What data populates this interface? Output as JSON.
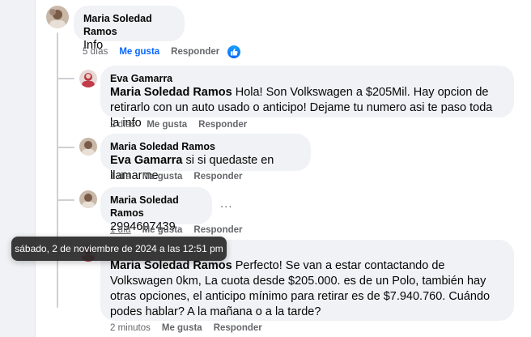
{
  "comments": [
    {
      "author": "Maria Soledad Ramos",
      "text": "Info",
      "time": "5 días",
      "like": "Me gusta",
      "reply": "Responder",
      "reaction": "like-icon"
    },
    {
      "author": "Eva Gamarra",
      "mention": "Maria Soledad Ramos",
      "text": " Hola! Son Volkswagen a $205Mil. Hay opcion de retirarlo con un auto usado o anticipo! Dejame tu numero asi te paso toda la info",
      "time": "2 días",
      "like": "Me gusta",
      "reply": "Responder"
    },
    {
      "author": "Maria Soledad Ramos",
      "mention": "Eva Gamarra",
      "text": " si si quedaste en llamarme",
      "time": "1 día",
      "like": "Me gusta",
      "reply": "Responder"
    },
    {
      "author": "Maria Soledad Ramos",
      "text": "2994697439",
      "time": "1 día",
      "like": "Me gusta",
      "reply": "Responder",
      "more": "..."
    },
    {
      "mention": "Maria Soledad Ramos",
      "text": " Perfecto! Se van a estar contactando de Volkswagen 0km, La cuota desde $205.000. es de un Polo, también hay otras opciones, el anticipo mínimo para retirar es de $7.940.760. Cuándo podes hablar? A la mañana o a la tarde?",
      "time": "2 minutos",
      "like": "Me gusta",
      "reply": "Responder"
    }
  ],
  "tooltip": "sábado, 2 de noviembre de 2024 a las 12:51 pm",
  "colors": {
    "bubble": "#f0f2f5",
    "meta": "#65676b",
    "accent": "#0866ff"
  }
}
